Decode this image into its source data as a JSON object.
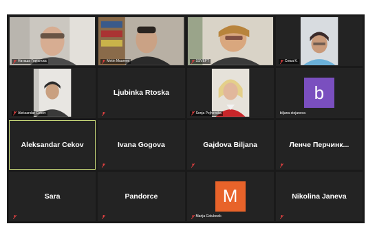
{
  "tiles": [
    {
      "name": "Наташа Горјанска",
      "type": "video"
    },
    {
      "name": "Metin Muaremi",
      "type": "video"
    },
    {
      "name": "SSVEFT",
      "type": "video"
    },
    {
      "name": "Соња К.",
      "type": "video"
    },
    {
      "name": "Aleksandar Cekov",
      "type": "video"
    },
    {
      "name": "Ljubinka Rtoska",
      "type": "name"
    },
    {
      "name": "Sonja Pejhovska",
      "type": "video"
    },
    {
      "name": "biljana stojanova",
      "type": "avatar",
      "initial": "b",
      "avatar_color": "#7a4fbf"
    },
    {
      "name": "Aleksandar Cekov",
      "type": "name",
      "active": true
    },
    {
      "name": "Ivana Gogova",
      "type": "name"
    },
    {
      "name": "Gajdova Biljana",
      "type": "name"
    },
    {
      "name": "Ленче Перчинк...",
      "type": "name"
    },
    {
      "name": "Sara",
      "type": "name"
    },
    {
      "name": "Pandorce",
      "type": "name"
    },
    {
      "name": "Marija Golubovik",
      "type": "avatar",
      "initial": "M",
      "avatar_color": "#e8632a"
    },
    {
      "name": "Nikolina Janeva",
      "type": "name"
    }
  ],
  "colors": {
    "muted_mic": "#e04040",
    "active_border": "#c9d97a",
    "tile_bg": "#232323"
  }
}
